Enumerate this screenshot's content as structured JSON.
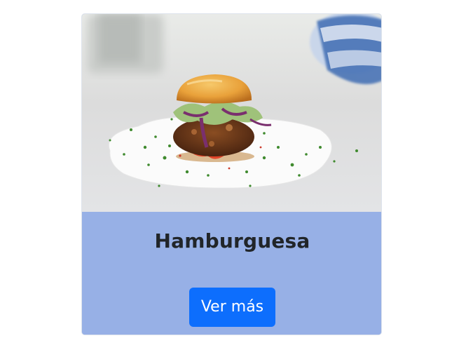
{
  "card": {
    "image_alt": "burger-photo",
    "title": "Hamburguesa",
    "button_label": "Ver más"
  },
  "colors": {
    "card_body_bg": "#97b0e6",
    "button_bg": "#0d6efd",
    "title_color": "#212529"
  }
}
